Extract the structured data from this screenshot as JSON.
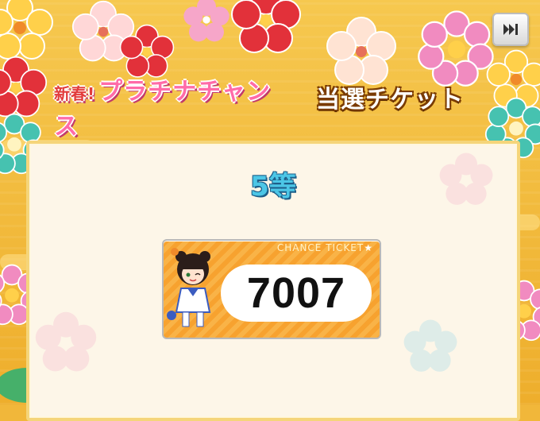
{
  "header": {
    "title_prefix": "新春!",
    "title_main": "プラチナチャンス",
    "ticket_label": "当選チケット"
  },
  "controls": {
    "skip_icon": "fast-forward-icon"
  },
  "result": {
    "rank": "5等",
    "ticket_header": "CHANCE TICKET",
    "ticket_star": "★",
    "ticket_number": "7007"
  },
  "colors": {
    "background": "#f1b73a",
    "panel": "#fdf6e8",
    "rank_text": "#4cc6e6",
    "ticket": "#f7a22f"
  }
}
